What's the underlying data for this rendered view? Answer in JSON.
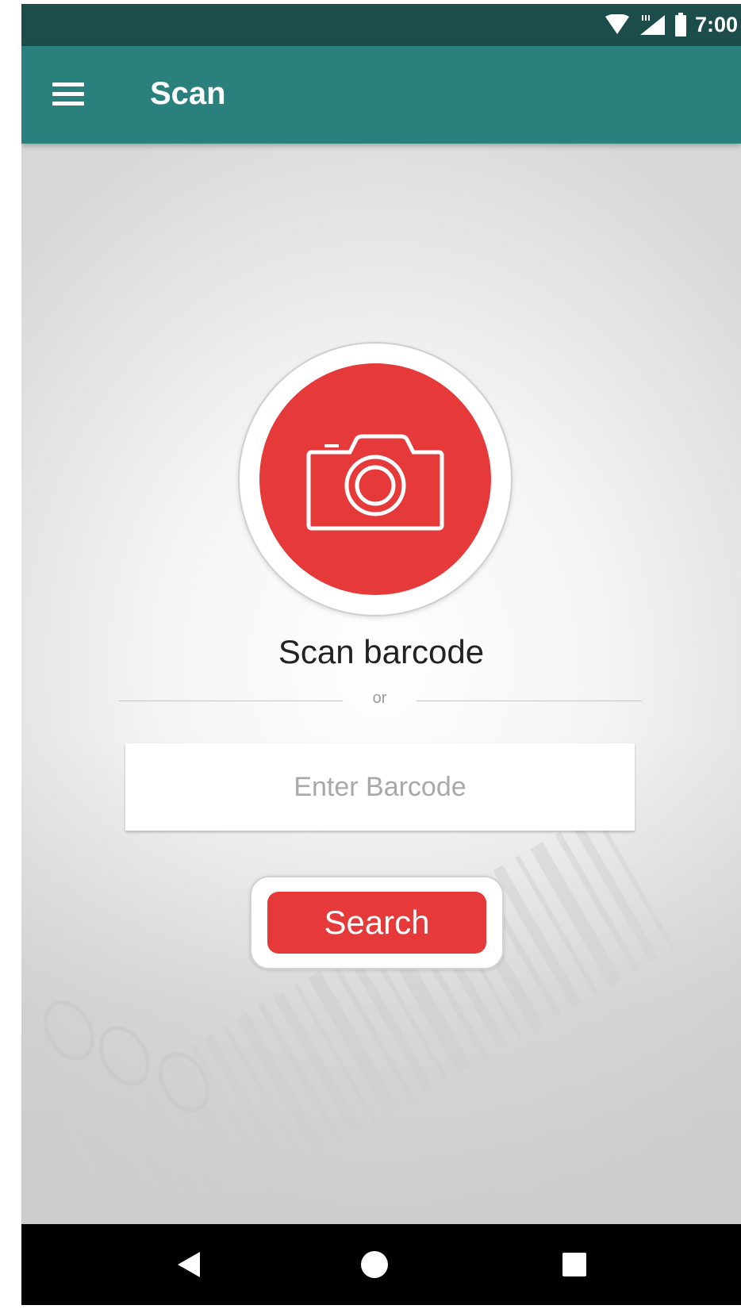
{
  "status_bar": {
    "time": "7:00",
    "icons": [
      "wifi-icon",
      "lte-signal-icon",
      "battery-icon"
    ]
  },
  "app_bar": {
    "title": "Scan",
    "menu_icon": "hamburger-menu-icon"
  },
  "main": {
    "scan_icon": "camera-icon",
    "scan_label": "Scan barcode",
    "divider_label": "or",
    "barcode_input": {
      "value": "",
      "placeholder": "Enter Barcode"
    },
    "search_button_label": "Search"
  },
  "nav_bar": {
    "icons": [
      "back-icon",
      "home-icon",
      "recents-icon"
    ]
  },
  "colors": {
    "status_bar": "#1d4d4b",
    "app_bar": "#2a807c",
    "accent": "#e63a3a",
    "nav_bar": "#000000"
  }
}
